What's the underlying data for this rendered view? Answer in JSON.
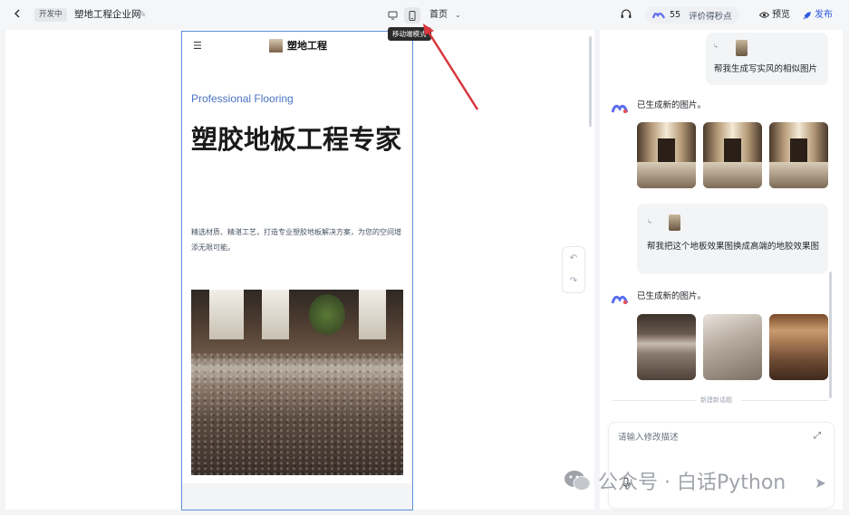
{
  "topbar": {
    "back_icon": "chevron-left-icon",
    "status_badge": "开发中",
    "project_title": "塑地工程企业网",
    "page_select": "首页",
    "device_tooltip": "移动端模式",
    "points": "55",
    "points_label": "评价得秒点",
    "preview_label": "预览",
    "publish_label": "发布"
  },
  "site": {
    "brand": "塑地工程",
    "eyebrow": "Professional Flooring",
    "title": "塑胶地板工程专家",
    "description": "精选材质、精湛工艺，打造专业塑胶地板解决方案，为您的空间增添无限可能。"
  },
  "chat": {
    "messages": [
      {
        "role": "user",
        "text": "帮我生成写实风的相似图片"
      },
      {
        "role": "assistant",
        "text": "已生成新的图片。",
        "images": [
          "corridor-1",
          "corridor-2",
          "corridor-3"
        ]
      },
      {
        "role": "user",
        "text": "帮我把这个地板效果图换成高端的地胶效果图"
      },
      {
        "role": "assistant",
        "text": "已生成新的图片。",
        "images": [
          "floor-1",
          "floor-2",
          "floor-3"
        ]
      }
    ],
    "new_topic_label": "新建新话题",
    "input_placeholder": "请输入修改描述"
  },
  "watermark": {
    "text": "公众号 · 白话Python"
  },
  "colors": {
    "accent": "#2d5be3",
    "eyebrow": "#4a73c4",
    "arrow": "#d9363e"
  }
}
